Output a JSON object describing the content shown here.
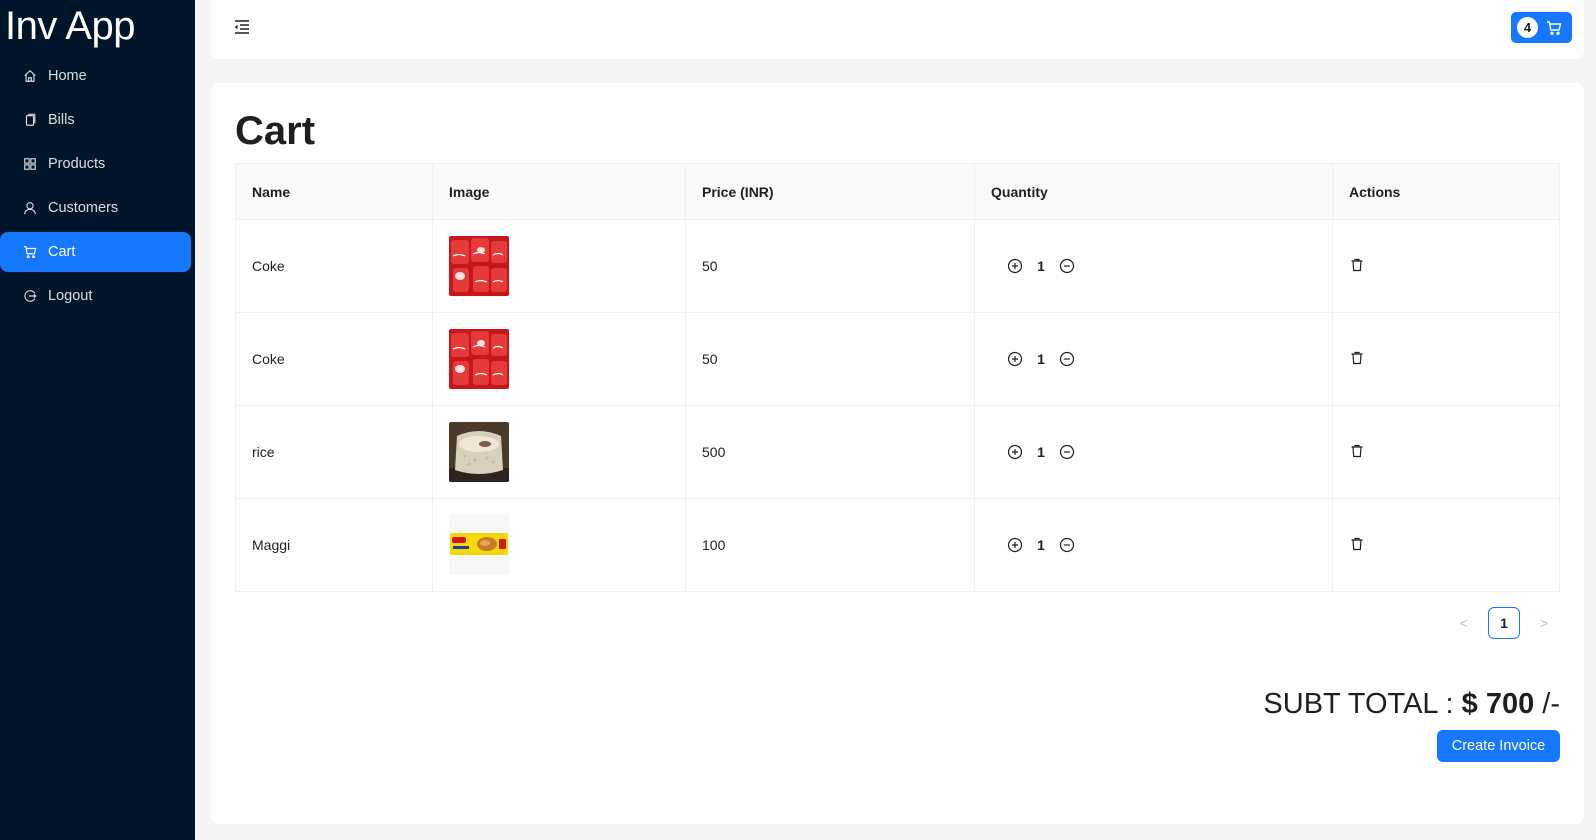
{
  "app": {
    "brand": "Inv App"
  },
  "sidebar": {
    "items": [
      {
        "label": "Home",
        "icon": "home-icon",
        "active": false
      },
      {
        "label": "Bills",
        "icon": "copy-icon",
        "active": false
      },
      {
        "label": "Products",
        "icon": "appstore-icon",
        "active": false
      },
      {
        "label": "Customers",
        "icon": "user-icon",
        "active": false
      },
      {
        "label": "Cart",
        "icon": "cart-icon",
        "active": true
      },
      {
        "label": "Logout",
        "icon": "logout-icon",
        "active": false
      }
    ]
  },
  "header": {
    "cart_count": "4"
  },
  "page": {
    "title": "Cart"
  },
  "table": {
    "columns": [
      "Name",
      "Image",
      "Price (INR)",
      "Quantity",
      "Actions"
    ],
    "rows": [
      {
        "name": "Coke",
        "image": "coke-can-image",
        "price": "50",
        "quantity": "1"
      },
      {
        "name": "Coke",
        "image": "coke-can-image",
        "price": "50",
        "quantity": "1"
      },
      {
        "name": "rice",
        "image": "rice-sack-image",
        "price": "500",
        "quantity": "1"
      },
      {
        "name": "Maggi",
        "image": "maggi-pack-image",
        "price": "100",
        "quantity": "1"
      }
    ]
  },
  "pagination": {
    "prev": "<",
    "current": "1",
    "next": ">"
  },
  "summary": {
    "label": "SUBT TOTAL : ",
    "amount": "$ 700",
    "suffix": " /-"
  },
  "actions": {
    "create_invoice": "Create Invoice"
  },
  "colors": {
    "sidebar_bg": "#001529",
    "primary": "#1677ff",
    "page_bg": "#f5f5f5"
  }
}
